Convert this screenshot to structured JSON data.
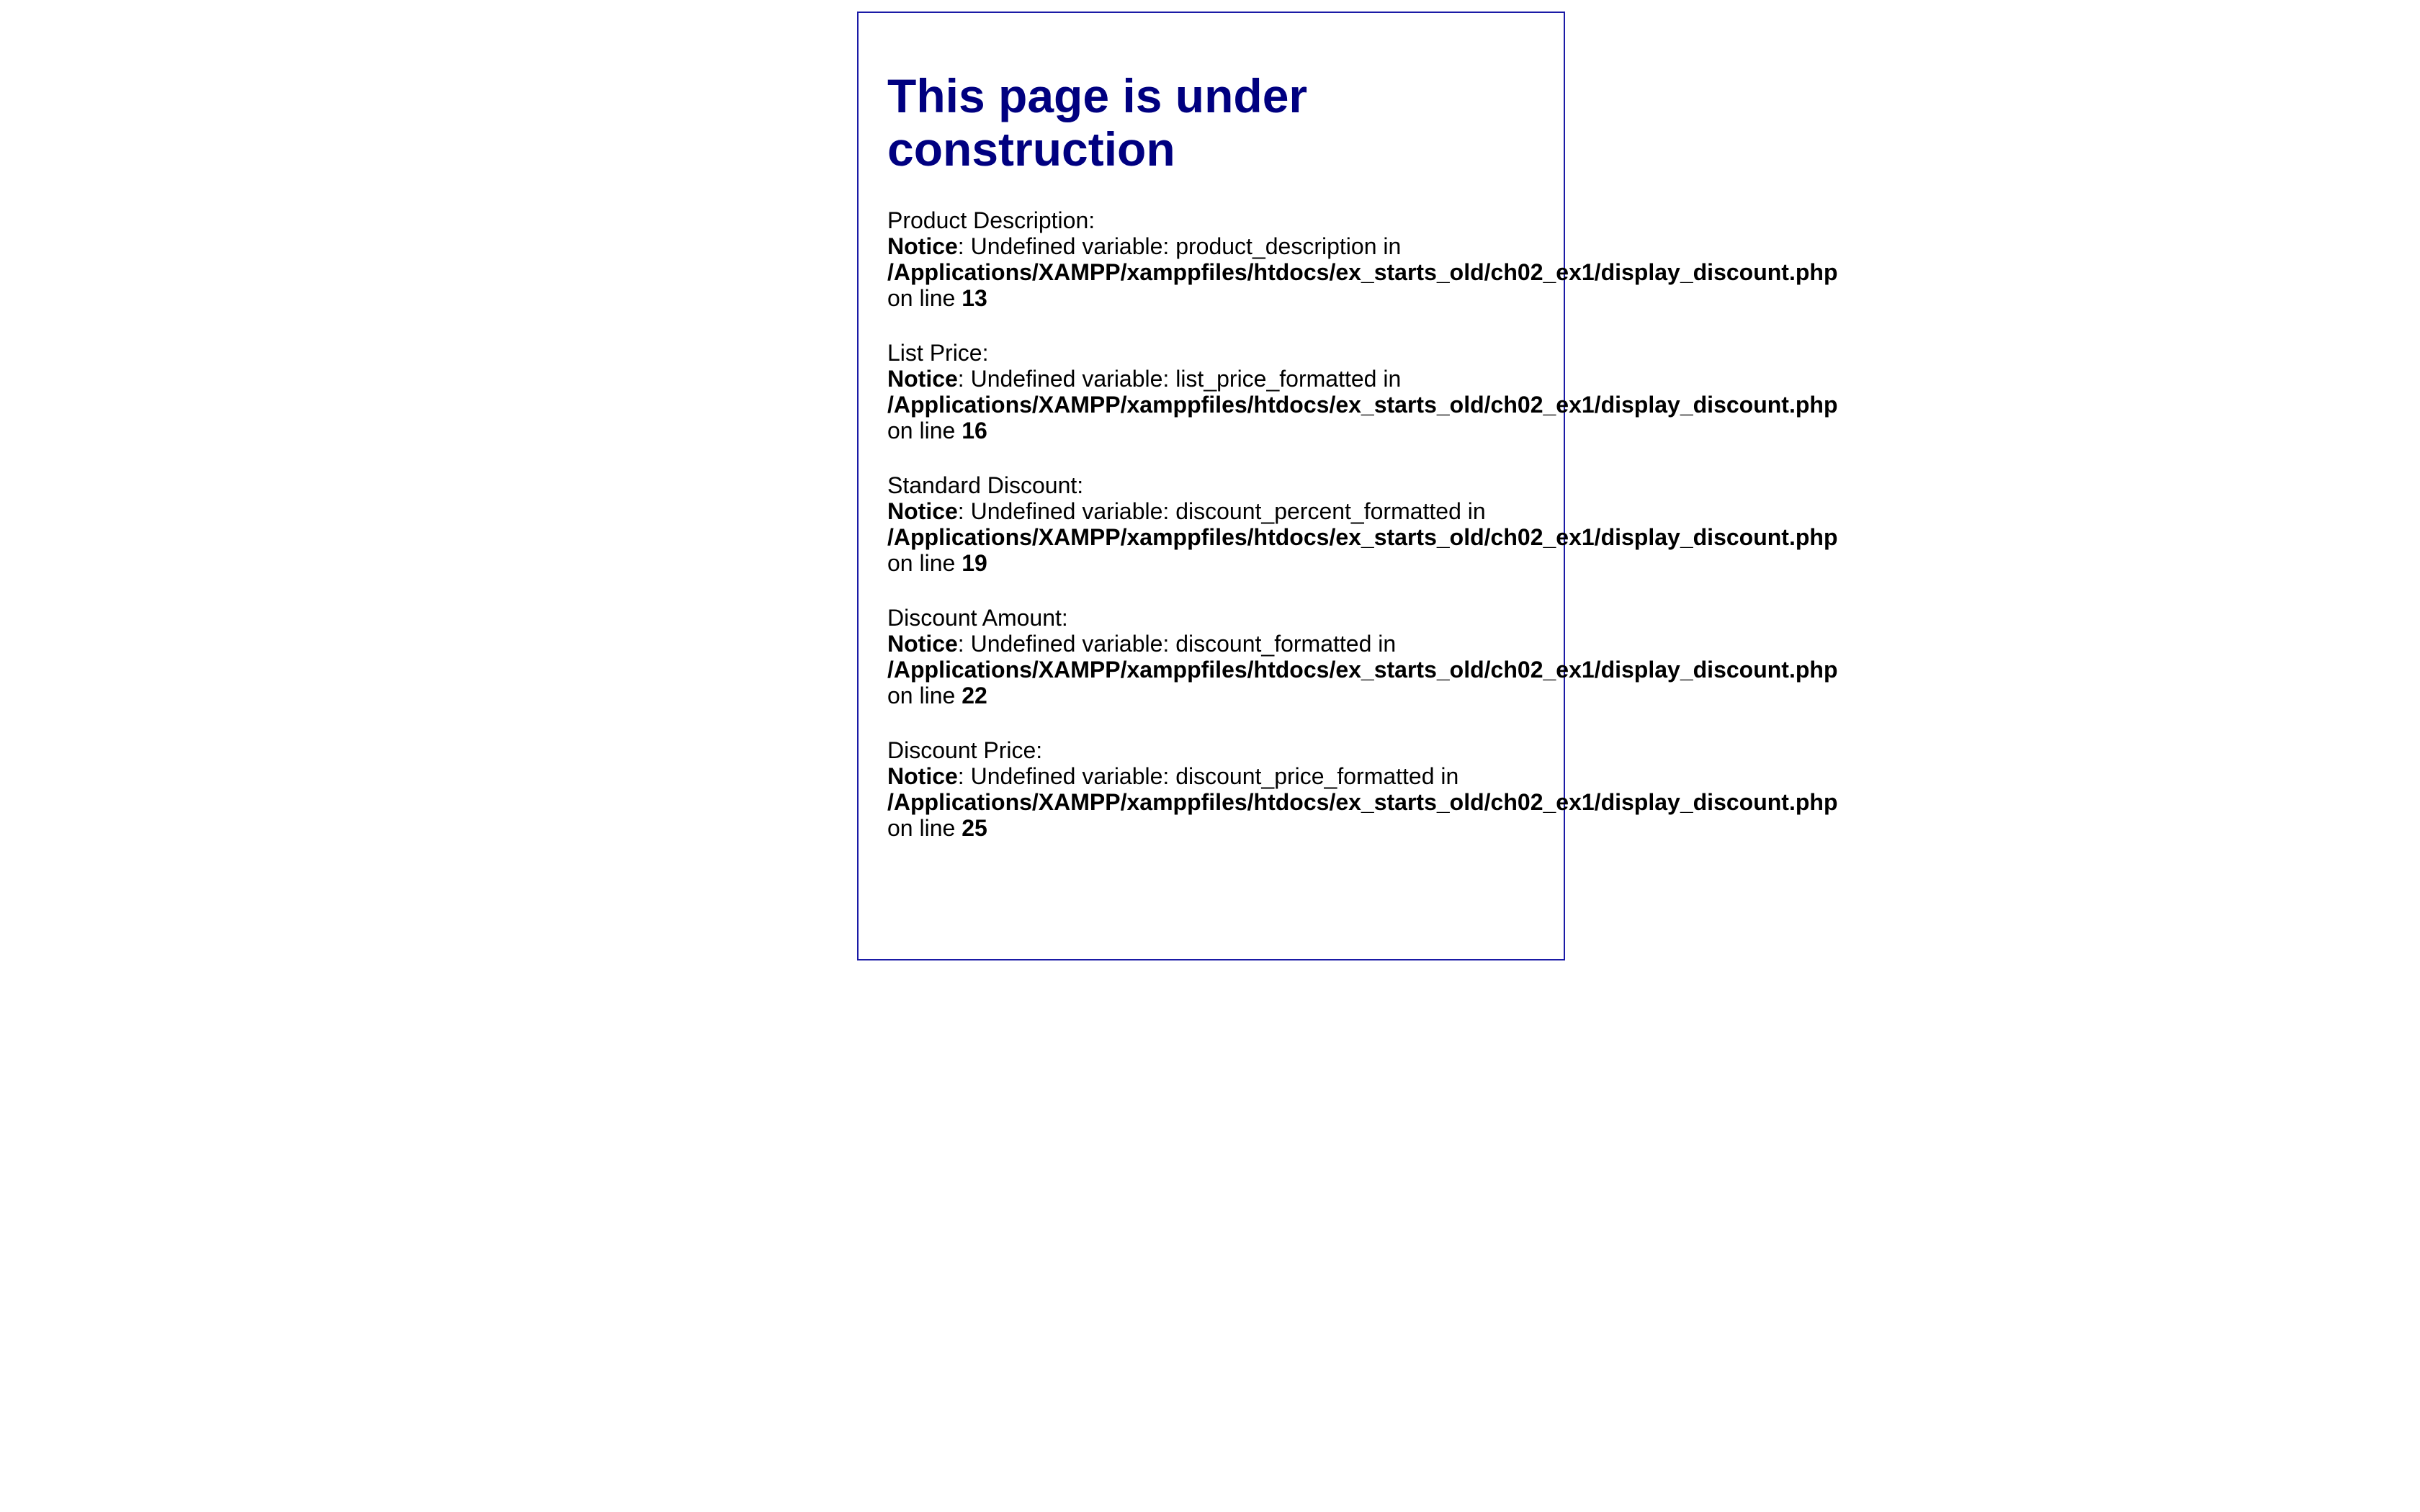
{
  "page": {
    "title": "This page is under construction"
  },
  "colors": {
    "heading": "#000080",
    "frame_border": "#1a1aa6",
    "text": "#000000",
    "background": "#ffffff"
  },
  "notice_word": "Notice",
  "notice_sep": ": Undefined variable: ",
  "in_word": " in",
  "on_line_word": "on line ",
  "fields": [
    {
      "label": "Product Description:",
      "variable": "product_description",
      "path": "/Applications/XAMPP/xamppfiles/htdocs/ex_starts_old/ch02_ex1/display_discount.php",
      "line": "13"
    },
    {
      "label": "List Price:",
      "variable": "list_price_formatted",
      "path": "/Applications/XAMPP/xamppfiles/htdocs/ex_starts_old/ch02_ex1/display_discount.php",
      "line": "16"
    },
    {
      "label": "Standard Discount:",
      "variable": "discount_percent_formatted",
      "path": "/Applications/XAMPP/xamppfiles/htdocs/ex_starts_old/ch02_ex1/display_discount.php",
      "line": "19"
    },
    {
      "label": "Discount Amount:",
      "variable": "discount_formatted",
      "path": "/Applications/XAMPP/xamppfiles/htdocs/ex_starts_old/ch02_ex1/display_discount.php",
      "line": "22"
    },
    {
      "label": "Discount Price:",
      "variable": "discount_price_formatted",
      "path": "/Applications/XAMPP/xamppfiles/htdocs/ex_starts_old/ch02_ex1/display_discount.php",
      "line": "25"
    }
  ]
}
